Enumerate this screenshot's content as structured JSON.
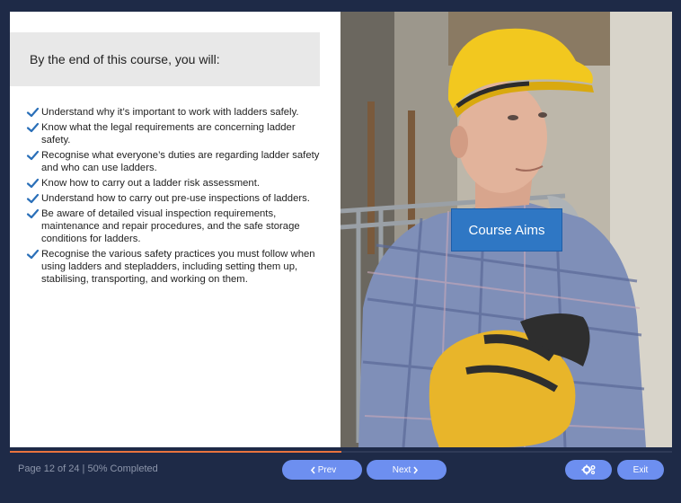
{
  "content": {
    "intro": "By the end of this course, you will:",
    "aims": [
      "Understand why it’s important to work with ladders safely.",
      "Know what the legal requirements are concerning ladder safety.",
      "Recognise what everyone’s duties are regarding ladder safety and who can use ladders.",
      "Know how to carry out a ladder risk assessment.",
      "Understand how to carry out pre-use inspections of ladders.",
      "Be aware of detailed visual inspection requirements, maintenance and repair procedures, and the safe storage conditions for ladders.",
      "Recognise the various safety practices you must follow when using ladders and stepladders, including setting them up, stabilising, transporting, and working on them."
    ],
    "badge": "Course Aims"
  },
  "footer": {
    "status": "Page 12 of 24 | 50% Completed",
    "progress_fraction": 0.5,
    "prev_label": "Prev",
    "next_label": "Next",
    "exit_label": "Exit",
    "settings_icon": "gears-icon"
  },
  "colors": {
    "background": "#1e2a47",
    "button": "#6d8ff0",
    "progress": "#e9733e",
    "badge": "#2f77c4",
    "tick": "#2a6fb8"
  }
}
